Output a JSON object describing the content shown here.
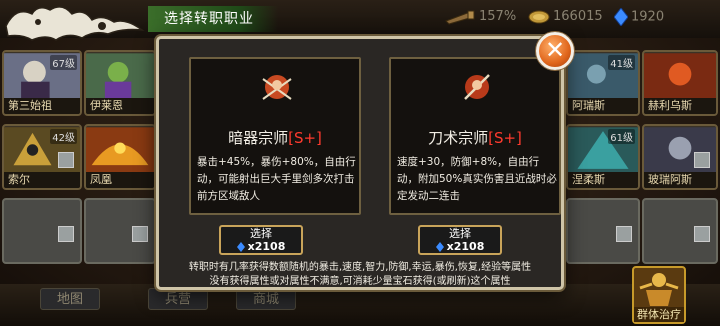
{
  "header": {
    "title": "选择转职职业",
    "resources": [
      {
        "icon": "telescope-icon",
        "value": "157%"
      },
      {
        "icon": "gold-coin-icon",
        "value": "166015"
      },
      {
        "icon": "blue-gem-icon",
        "value": "1920"
      }
    ]
  },
  "roster": {
    "left": [
      {
        "name": "第三始祖",
        "level": "67级"
      },
      {
        "name": "伊莱恩",
        "level": ""
      },
      {
        "name": "索尔",
        "level": "42级"
      },
      {
        "name": "凤凰",
        "level": ""
      }
    ],
    "right": [
      {
        "name": "",
        "level": "41级"
      },
      {
        "name": "",
        "level": ""
      },
      {
        "name": "阿瑞斯",
        "level": ""
      },
      {
        "name": "赫利乌斯",
        "level": ""
      },
      {
        "name": "涅柔斯",
        "level": "61级"
      },
      {
        "name": "玻瑞阿斯",
        "level": ""
      }
    ]
  },
  "dialog": {
    "jobs": [
      {
        "name": "暗器宗师",
        "rank": "[S+]",
        "description": "暴击+45%，暴伤+80%，自由行动，可能射出巨大手里剑多次打击前方区域敌人",
        "select_label": "选择",
        "cost": "x2108"
      },
      {
        "name": "刀术宗师",
        "rank": "[S+]",
        "description": "速度+30，防御+8%，自由行动，附加50%真实伤害且近战时必定发动二连击",
        "select_label": "选择",
        "cost": "x2108"
      }
    ],
    "note_line1": "转职时有几率获得数额随机的暴击,速度,智力,防御,幸运,暴伤,恢复,经验等属性",
    "note_line2": "没有获得属性或对属性不满意,可消耗少量宝石获得(或刷新)这个属性"
  },
  "bottom_nav": {
    "items": [
      "地图",
      "兵营",
      "商城"
    ],
    "heal_label": "群体治疗"
  },
  "colors": {
    "rank_red": "#ff3a2e",
    "gem_blue": "#3b8bff",
    "frame_gold": "#c9a45a"
  }
}
